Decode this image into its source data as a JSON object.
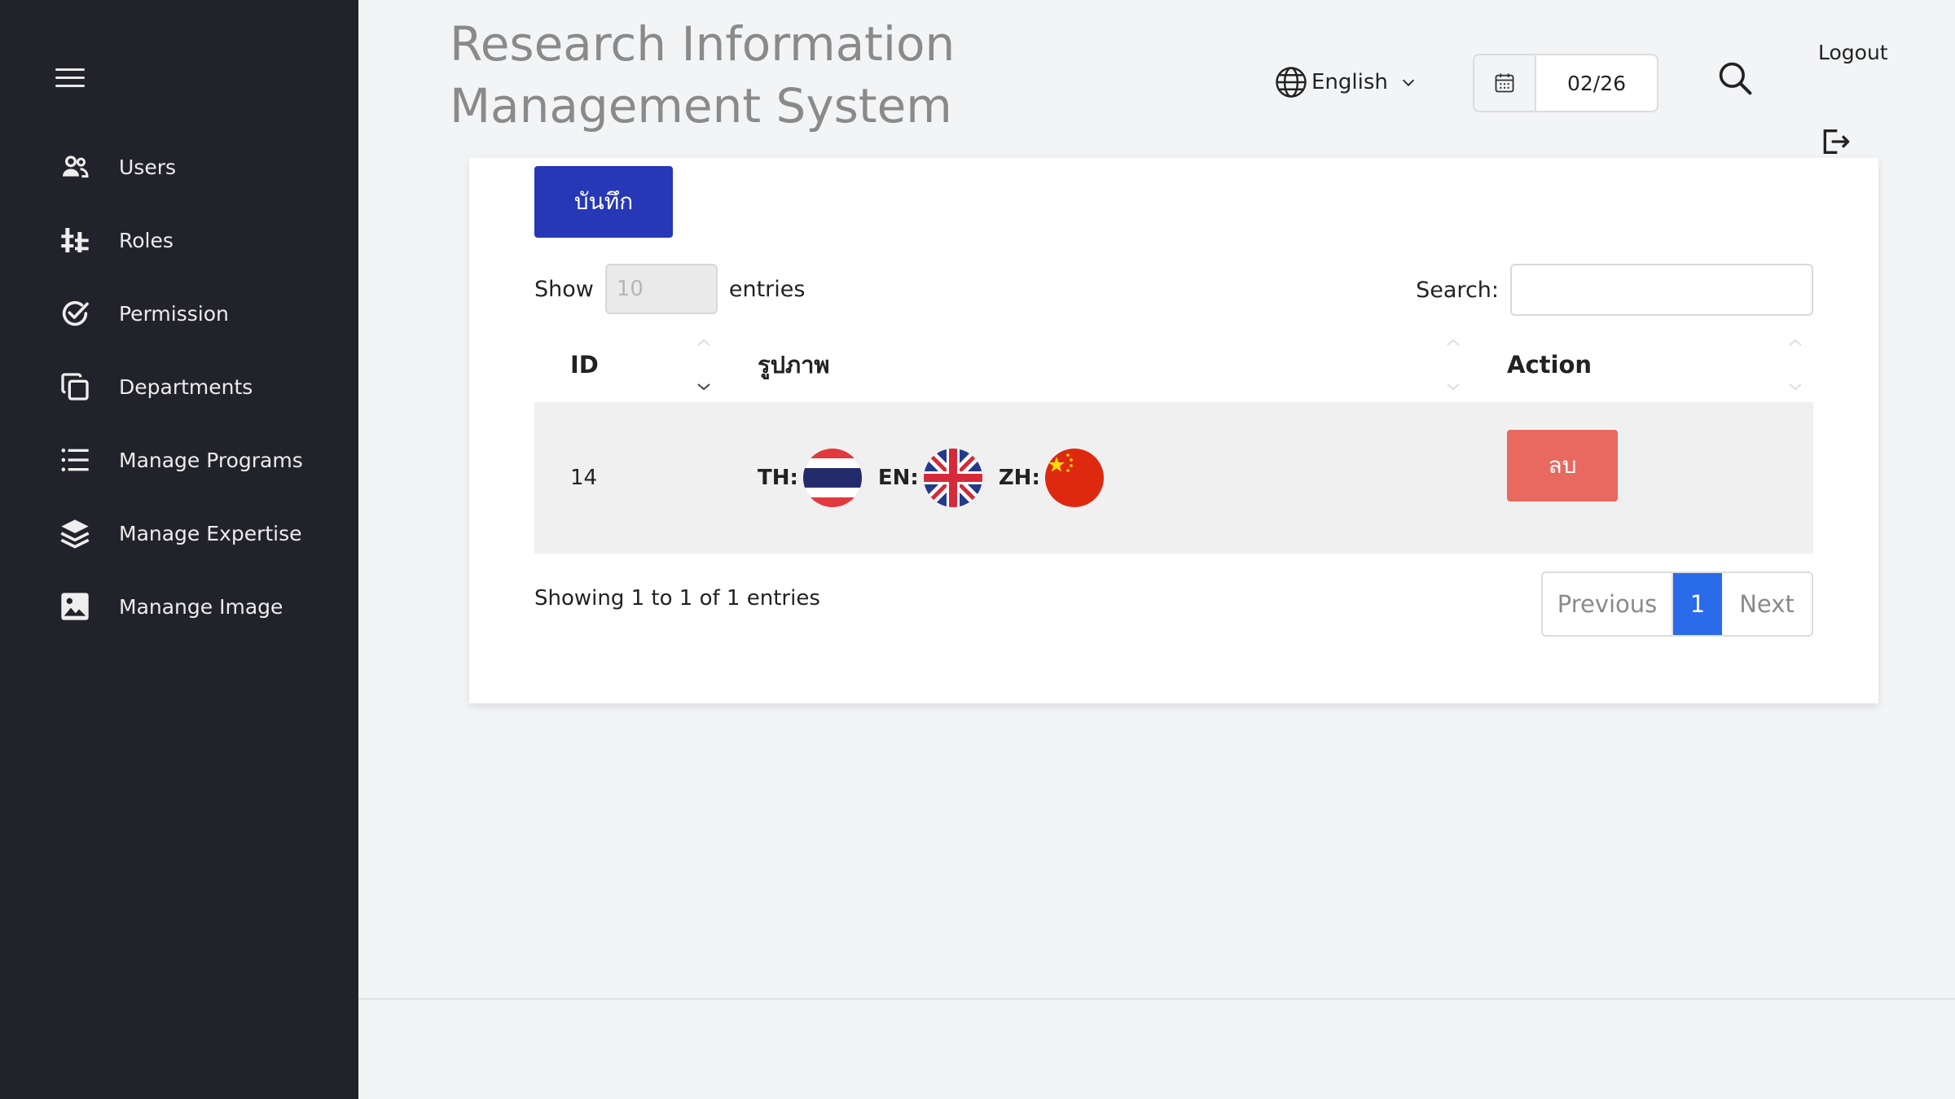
{
  "app": {
    "title": "Research Information Management System"
  },
  "header": {
    "language": "English",
    "date_value": "02/26",
    "logout_label": "Logout"
  },
  "sidebar": {
    "items": [
      {
        "label": "Users",
        "icon": "users-icon"
      },
      {
        "label": "Roles",
        "icon": "roles-icon"
      },
      {
        "label": "Permission",
        "icon": "permission-icon"
      },
      {
        "label": "Departments",
        "icon": "departments-icon"
      },
      {
        "label": "Manage Programs",
        "icon": "list-icon"
      },
      {
        "label": "Manage Expertise",
        "icon": "layers-icon"
      },
      {
        "label": "Manange Image",
        "icon": "image-icon"
      }
    ]
  },
  "main": {
    "save_label": "บันทึก",
    "show_label": "Show",
    "entries_value": "10",
    "entries_label": "entries",
    "search_label": "Search:",
    "search_value": "",
    "table": {
      "columns": [
        "ID",
        "รูปภาพ",
        "Action"
      ],
      "rows": [
        {
          "id": "14",
          "flags": [
            {
              "label": "TH:",
              "icon": "thailand-flag-icon"
            },
            {
              "label": "EN:",
              "icon": "uk-flag-icon"
            },
            {
              "label": "ZH:",
              "icon": "china-flag-icon"
            }
          ],
          "action_label": "ลบ"
        }
      ]
    },
    "info_text": "Showing 1 to 1 of 1 entries",
    "pagination": {
      "previous": "Previous",
      "current": "1",
      "next": "Next"
    }
  },
  "colors": {
    "sidebar_bg": "#22222a",
    "primary_button": "#2638b6",
    "danger_button": "#e8695f",
    "active_page": "#2a6bea",
    "page_bg": "#f3f4f6"
  }
}
